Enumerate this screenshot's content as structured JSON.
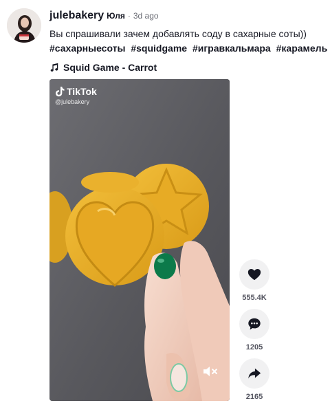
{
  "post": {
    "username": "julebakery",
    "nickname": "Юля",
    "separator": "·",
    "age": "3d ago",
    "caption": "Вы спрашивали зачем добавлять соду в сахарные соты))",
    "hashtags": [
      "#сахарныесоты",
      "#squidgame",
      "#игравкальмара",
      "#карамель"
    ],
    "music": "Squid Game - Carrot"
  },
  "video": {
    "watermark_brand": "TikTok",
    "watermark_handle": "@julebakery"
  },
  "actions": {
    "likes": "555.4K",
    "comments": "1205",
    "shares": "2165"
  },
  "icons": {
    "like": "heart-icon",
    "comment": "comment-bubble-icon",
    "share": "share-arrow-icon",
    "music": "music-note-icon",
    "mute": "speaker-muted-icon"
  },
  "colors": {
    "candy": "#e9ad24",
    "nail": "#0c7a4a",
    "text": "#161823",
    "muted": "#6b6d75"
  }
}
